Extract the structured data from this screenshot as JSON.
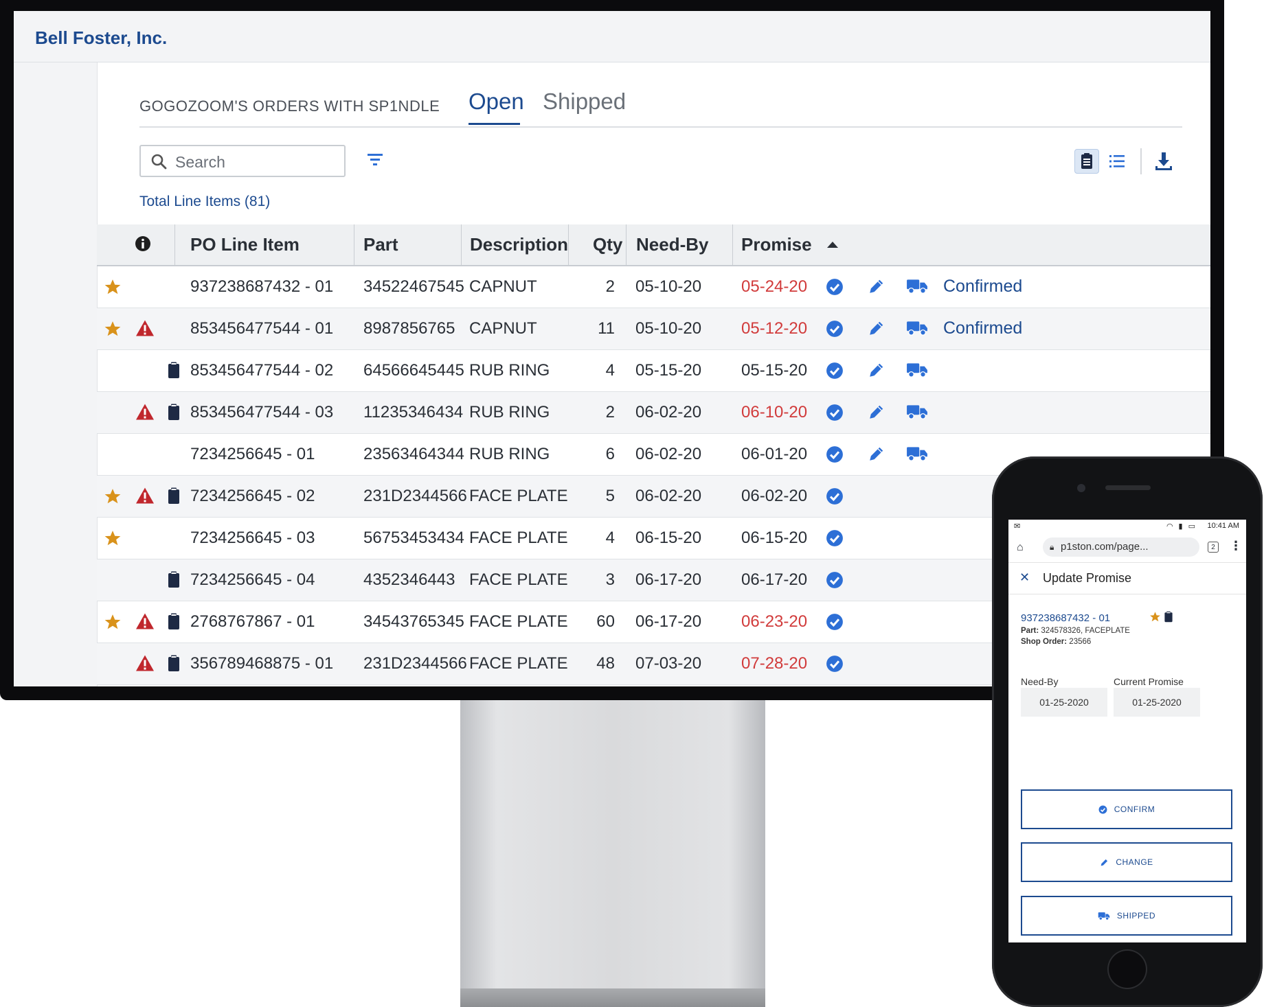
{
  "company": "Bell Foster, Inc.",
  "orders_title": "GOGOZOOM'S ORDERS WITH SP1NDLE",
  "tabs": [
    {
      "label": "Open",
      "active": true
    },
    {
      "label": "Shipped",
      "active": false
    }
  ],
  "search": {
    "placeholder": "Search",
    "value": ""
  },
  "total_items": "Total Line Items (81)",
  "table": {
    "headers": {
      "po": "PO Line Item",
      "part": "Part",
      "description": "Description",
      "qty": "Qty",
      "need_by": "Need-By",
      "promise": "Promise"
    },
    "sort": {
      "column": "need_by",
      "direction": "ascending"
    },
    "rows": [
      {
        "star": true,
        "warn": false,
        "clip": false,
        "po": "937238687432 - 01",
        "part": "34522467545",
        "description": "CAPNUT",
        "qty": "2",
        "need_by": "05-10-20",
        "promise": "05-24-20",
        "promise_late": true,
        "status": "Confirmed"
      },
      {
        "star": true,
        "warn": true,
        "clip": false,
        "po": "853456477544 - 01",
        "part": "8987856765",
        "description": "CAPNUT",
        "qty": "11",
        "need_by": "05-10-20",
        "promise": "05-12-20",
        "promise_late": true,
        "status": "Confirmed"
      },
      {
        "star": false,
        "warn": false,
        "clip": true,
        "po": "853456477544 - 02",
        "part": "64566645445",
        "description": "RUB RING",
        "qty": "4",
        "need_by": "05-15-20",
        "promise": "05-15-20",
        "promise_late": false,
        "status": ""
      },
      {
        "star": false,
        "warn": true,
        "clip": true,
        "po": "853456477544 - 03",
        "part": "11235346434",
        "description": "RUB RING",
        "qty": "2",
        "need_by": "06-02-20",
        "promise": "06-10-20",
        "promise_late": true,
        "status": ""
      },
      {
        "star": false,
        "warn": false,
        "clip": false,
        "po": "7234256645 - 01",
        "part": "23563464344",
        "description": "RUB RING",
        "qty": "6",
        "need_by": "06-02-20",
        "promise": "06-01-20",
        "promise_late": false,
        "status": ""
      },
      {
        "star": true,
        "warn": true,
        "clip": true,
        "po": "7234256645 - 02",
        "part": "231D2344566",
        "description": "FACE PLATE",
        "qty": "5",
        "need_by": "06-02-20",
        "promise": "06-02-20",
        "promise_late": false,
        "status": ""
      },
      {
        "star": true,
        "warn": false,
        "clip": false,
        "po": "7234256645 - 03",
        "part": "56753453434",
        "description": "FACE PLATE",
        "qty": "4",
        "need_by": "06-15-20",
        "promise": "06-15-20",
        "promise_late": false,
        "status": ""
      },
      {
        "star": false,
        "warn": false,
        "clip": true,
        "po": "7234256645 - 04",
        "part": "4352346443",
        "description": "FACE PLATE",
        "qty": "3",
        "need_by": "06-17-20",
        "promise": "06-17-20",
        "promise_late": false,
        "status": ""
      },
      {
        "star": true,
        "warn": true,
        "clip": true,
        "po": "2768767867 - 01",
        "part": "34543765345",
        "description": "FACE PLATE",
        "qty": "60",
        "need_by": "06-17-20",
        "promise": "06-23-20",
        "promise_late": true,
        "status": ""
      },
      {
        "star": false,
        "warn": true,
        "clip": true,
        "po": "356789468875 - 01",
        "part": "231D2344566",
        "description": "FACE PLATE",
        "qty": "48",
        "need_by": "07-03-20",
        "promise": "07-28-20",
        "promise_late": true,
        "status": ""
      }
    ]
  },
  "phone": {
    "time": "10:41 AM",
    "url": "p1ston.com/page...",
    "tab_count": "2",
    "modal_title": "Update Promise",
    "po": "937238687432 - 01",
    "part_label": "Part:",
    "part_value": "324578326, FACEPLATE",
    "shop_label": "Shop Order:",
    "shop_value": "23566",
    "need_by_label": "Need-By",
    "need_by_value": "01-25-2020",
    "current_promise_label": "Current Promise",
    "current_promise_value": "01-25-2020",
    "buttons": {
      "confirm": "CONFIRM",
      "change": "CHANGE",
      "shipped": "SHIPPED"
    }
  },
  "colors": {
    "brand": "#1c4a8f",
    "icon_blue": "#2d6fd6",
    "late_red": "#d13b3b",
    "star": "#d9921b",
    "warning": "#c0272d",
    "clipboard": "#1e2a44"
  }
}
